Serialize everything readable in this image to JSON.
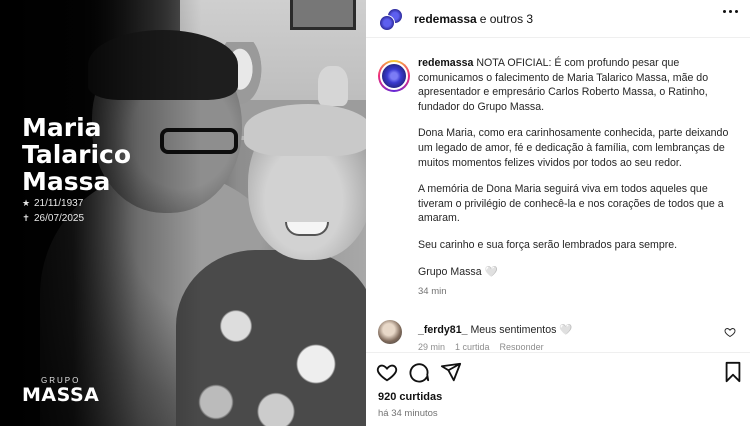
{
  "memorial": {
    "name_lines": [
      "Maria",
      "Talarico",
      "Massa"
    ],
    "birth_symbol": "★",
    "birth_date": "21/11/1937",
    "death_symbol": "✝",
    "death_date": "26/07/2025",
    "brand_small": "GRUPO",
    "brand_big": "MASSA"
  },
  "post": {
    "header_user": "redemassa",
    "header_others": "e outros 3",
    "caption_user": "redemassa",
    "caption_paragraphs": [
      "NOTA OFICIAL: É com profundo pesar que comunicamos o falecimento de Maria Talarico Massa, mãe do apresentador e empresário Carlos Roberto Massa, o Ratinho, fundador do Grupo Massa.",
      "Dona Maria, como era carinhosamente conhecida, parte deixando um legado de amor, fé e dedicação à família, com lembranças de muitos momentos felizes vividos por todos ao seu redor.",
      "A memória de Dona Maria seguirá viva em todos aqueles que tiveram o privilégio de conhecê-la e nos corações de todos que a amaram.",
      "Seu carinho e sua força serão lembrados para sempre.",
      "Grupo Massa 🤍"
    ],
    "caption_time": "34 min",
    "comment": {
      "user": "_ferdy81_",
      "text": "Meus sentimentos 🤍",
      "time": "29 min",
      "likes": "1 curtida",
      "reply": "Responder"
    },
    "likes": "920 curtidas",
    "posted": "há 34 minutos"
  }
}
